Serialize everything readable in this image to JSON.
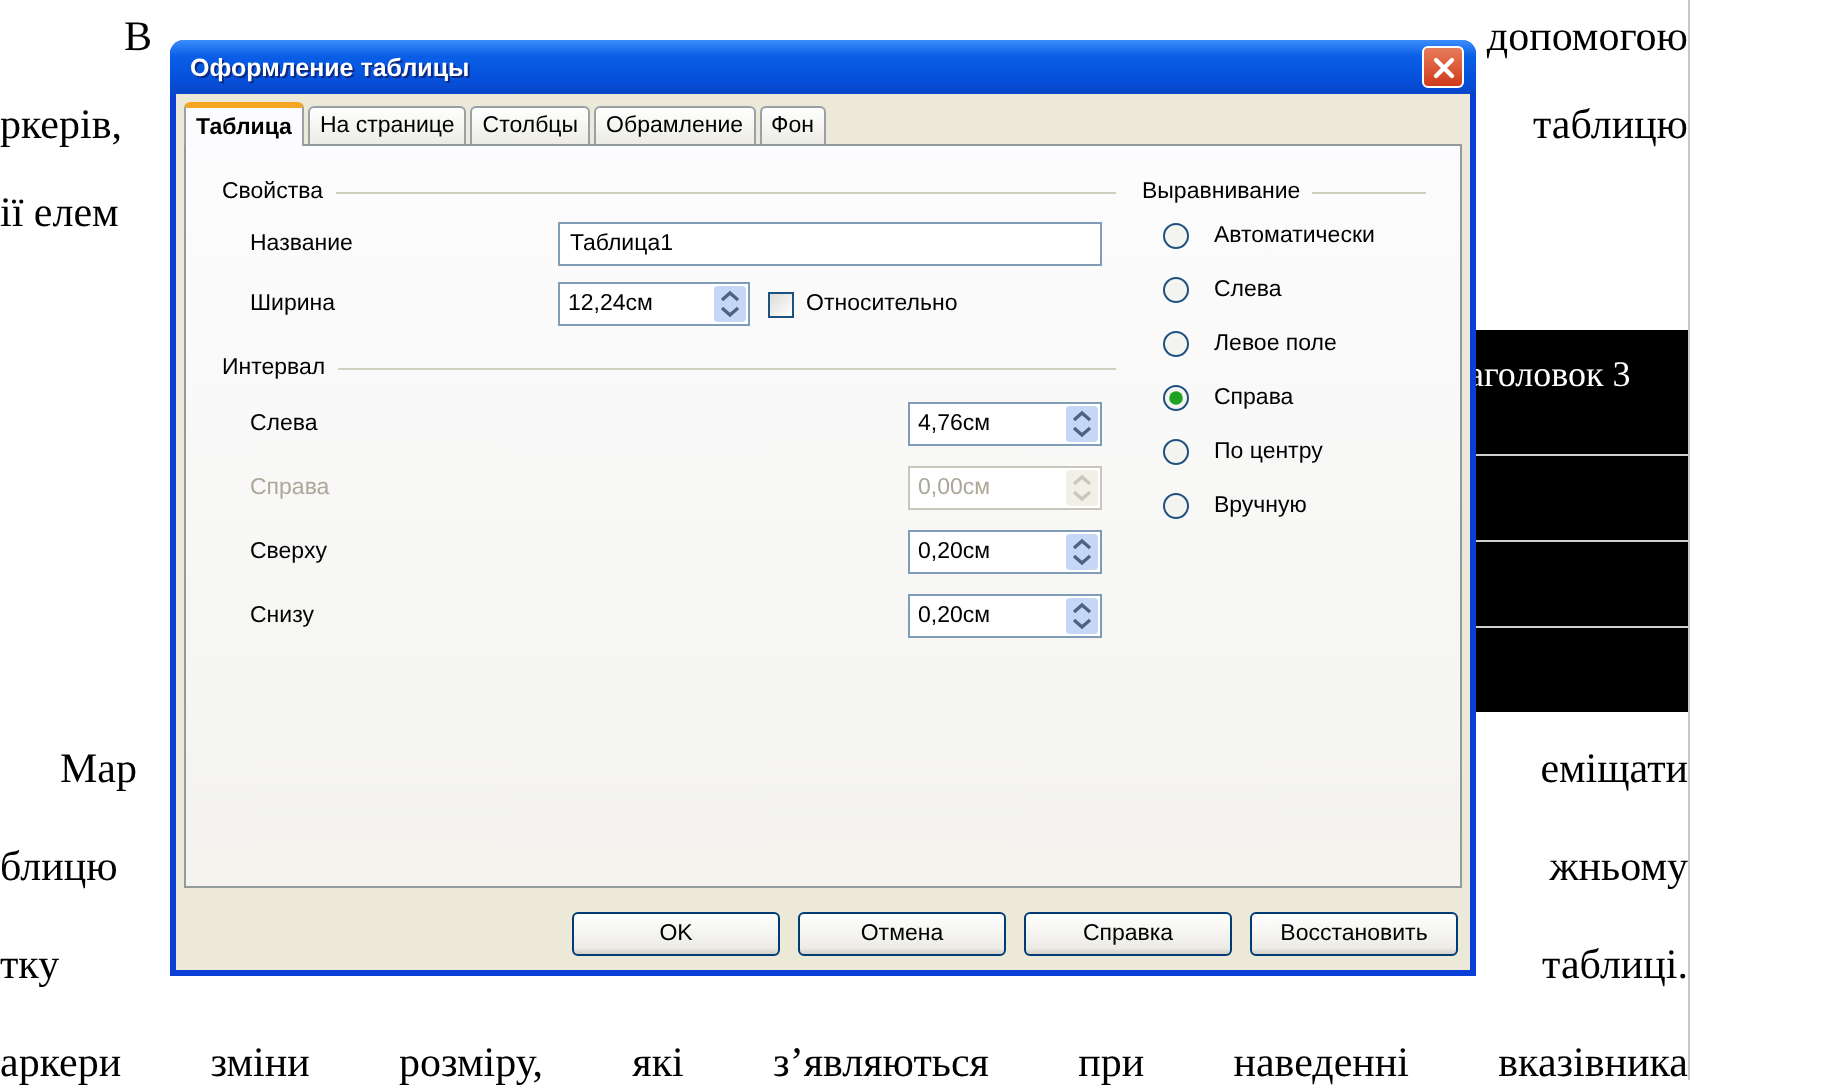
{
  "document": {
    "blocks": [
      {
        "kind": "split",
        "indent": true,
        "left": "В",
        "right": "допомогою"
      },
      {
        "kind": "split",
        "indent": false,
        "left": "ркерів,",
        "right": "таблицю"
      },
      {
        "kind": "split",
        "indent": false,
        "left": "ії елем"
      },
      {
        "kind": "table",
        "header": "аголовок 3"
      },
      {
        "kind": "split",
        "indent": true,
        "left": "Мар",
        "right": "еміщати"
      },
      {
        "kind": "split",
        "indent": false,
        "left": "блицю",
        "right": "жньому"
      },
      {
        "kind": "split",
        "indent": false,
        "left": "тку",
        "right": "таблиці."
      },
      {
        "kind": "full",
        "indent": false,
        "text": "аркери зміни розміру, які з’являються при наведенні вказівника"
      }
    ]
  },
  "dialog": {
    "title": "Оформление таблицы",
    "tabs": [
      {
        "label": "Таблица",
        "selected": true
      },
      {
        "label": "На странице",
        "selected": false
      },
      {
        "label": "Столбцы",
        "selected": false
      },
      {
        "label": "Обрамление",
        "selected": false
      },
      {
        "label": "Фон",
        "selected": false
      }
    ],
    "properties": {
      "heading": "Свойства",
      "name": {
        "label": "Название",
        "value": "Таблица1"
      },
      "width": {
        "label": "Ширина",
        "value": "12,24см"
      },
      "relative": {
        "label": "Относительно",
        "checked": false
      }
    },
    "spacing": {
      "heading": "Интервал",
      "rows": [
        {
          "label": "Слева",
          "value": "4,76см",
          "disabled": false
        },
        {
          "label": "Справа",
          "value": "0,00см",
          "disabled": true
        },
        {
          "label": "Сверху",
          "value": "0,20см",
          "disabled": false
        },
        {
          "label": "Снизу",
          "value": "0,20см",
          "disabled": false
        }
      ]
    },
    "alignment": {
      "heading": "Выравнивание",
      "options": [
        {
          "label": "Автоматически",
          "selected": false
        },
        {
          "label": "Слева",
          "selected": false
        },
        {
          "label": "Левое поле",
          "selected": false
        },
        {
          "label": "Справа",
          "selected": true
        },
        {
          "label": "По центру",
          "selected": false
        },
        {
          "label": "Вручную",
          "selected": false
        }
      ]
    },
    "buttons": [
      {
        "label": "OK"
      },
      {
        "label": "Отмена"
      },
      {
        "label": "Справка"
      },
      {
        "label": "Восстановить"
      }
    ]
  }
}
